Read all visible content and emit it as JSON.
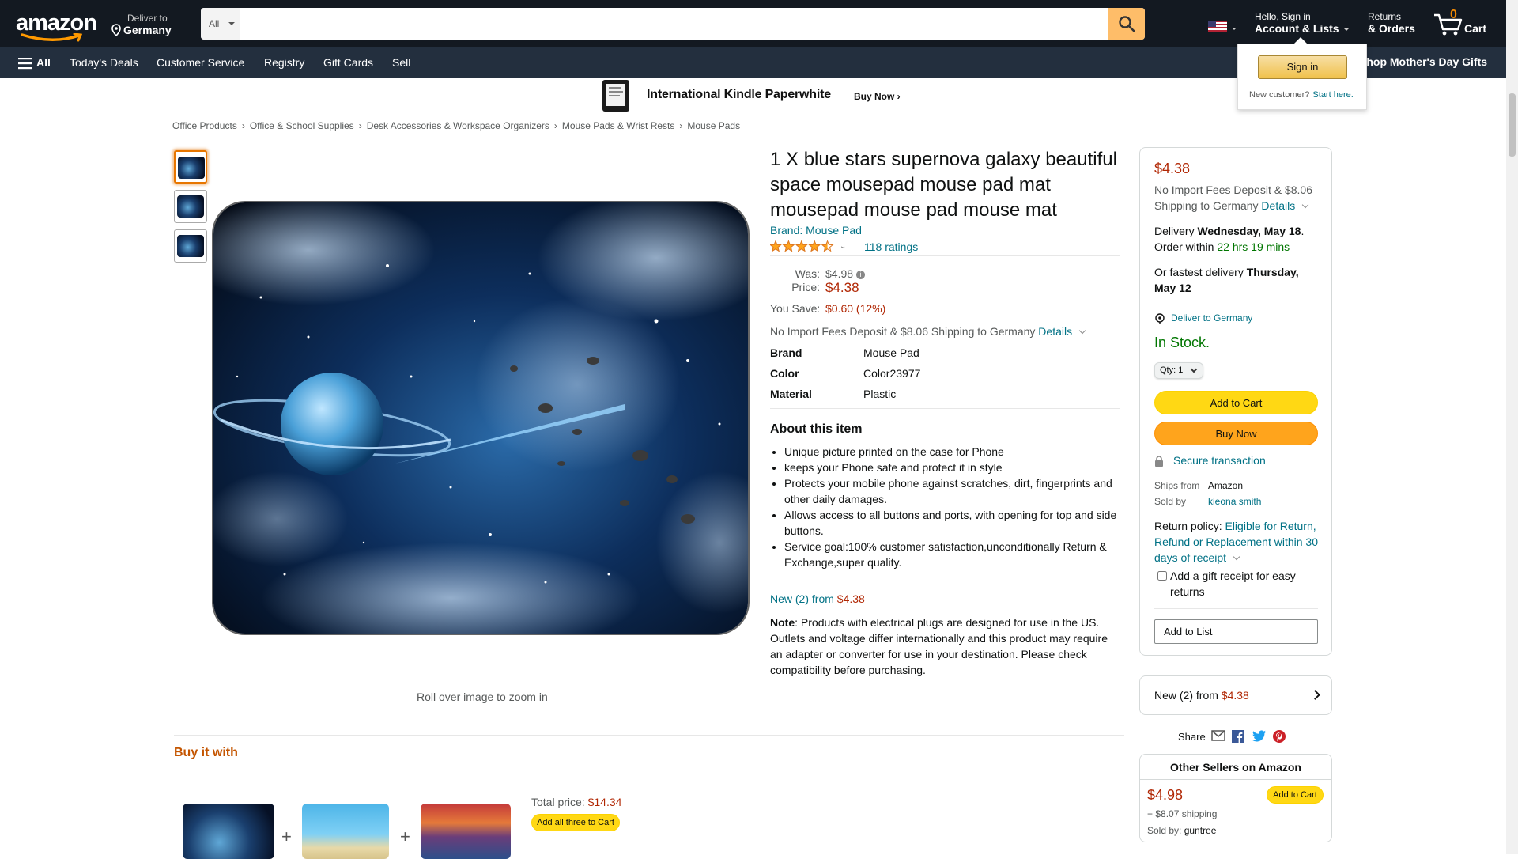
{
  "header": {
    "logo_text": "amazon",
    "deliver_line1": "Deliver to",
    "deliver_line2": "Germany",
    "search_category": "All",
    "search_placeholder": "",
    "account_line1": "Hello, Sign in",
    "account_line2": "Account & Lists",
    "returns_line1": "Returns",
    "returns_line2": "& Orders",
    "cart_count": "0",
    "cart_label": "Cart"
  },
  "nav": {
    "all_label": "All",
    "items": [
      "Today's Deals",
      "Customer Service",
      "Registry",
      "Gift Cards",
      "Sell"
    ],
    "promo": "Shop Mother's Day Gifts"
  },
  "signin_flyout": {
    "button": "Sign in",
    "new_customer": "New customer?",
    "start_here": "Start here."
  },
  "banner": {
    "text": "International Kindle Paperwhite",
    "cta": "Buy Now ›"
  },
  "breadcrumb": [
    "Office Products",
    "Office & School Supplies",
    "Desk Accessories & Workspace Organizers",
    "Mouse Pads & Wrist Rests",
    "Mouse Pads"
  ],
  "gallery": {
    "zoom_hint": "Roll over image to zoom in"
  },
  "product": {
    "title": "1 X blue stars supernova galaxy beautiful space mousepad mouse pad mat mousepad mouse pad mouse mat",
    "brand_link": "Brand: Mouse Pad",
    "rating": 4.5,
    "ratings_count": "118 ratings",
    "was_label": "Was:",
    "was_price": "$4.98",
    "price_label": "Price:",
    "price": "$4.38",
    "save_label": "You Save:",
    "save_value": "$0.60 (12%)",
    "import_text": "No Import Fees Deposit & $8.06 Shipping to Germany",
    "details_link": "Details",
    "specs": [
      {
        "k": "Brand",
        "v": "Mouse Pad"
      },
      {
        "k": "Color",
        "v": "Color23977"
      },
      {
        "k": "Material",
        "v": "Plastic"
      }
    ],
    "about_title": "About this item",
    "about": [
      "Unique picture printed on the case for Phone",
      "keeps your Phone safe and protect it in style",
      "Protects your mobile phone against scratches, dirt, fingerprints and other daily damages.",
      "Allows access to all buttons and ports, with opening for top and side buttons.",
      "Service goal:100% customer satisfaction,unconditionally Return & Exchange,super quality."
    ],
    "new_from_label": "New (2) from",
    "new_from_price": "$4.38",
    "note_label": "Note",
    "note_text": ": Products with electrical plugs are designed for use in the US. Outlets and voltage differ internationally and this product may require an adapter or converter for use in your destination. Please check compatibility before purchasing."
  },
  "buybox": {
    "price": "$4.38",
    "import_text": "No Import Fees Deposit & $8.06 Shipping to Germany",
    "details_link": "Details",
    "delivery_prefix": "Delivery",
    "delivery_date": "Wednesday, May 18",
    "order_within_prefix": "Order within",
    "order_within": "22 hrs 19 mins",
    "fastest_prefix": "Or fastest delivery",
    "fastest_date": "Thursday, May 12",
    "deliver_to": "Deliver to Germany",
    "stock": "In Stock.",
    "qty": "Qty:  1",
    "add_to_cart": "Add to Cart",
    "buy_now": "Buy Now",
    "secure": "Secure transaction",
    "ships_from_label": "Ships from",
    "ships_from": "Amazon",
    "sold_by_label": "Sold by",
    "sold_by": "kieona smith",
    "return_prefix": "Return policy:",
    "return_link": "Eligible for Return, Refund or Replacement within 30 days of receipt",
    "gift_receipt": "Add a gift receipt for easy returns",
    "add_to_list": "Add to List"
  },
  "new_box": {
    "label": "New (2) from",
    "price": "$4.38"
  },
  "share": {
    "label": "Share"
  },
  "other_sellers": {
    "title": "Other Sellers on Amazon",
    "price": "$4.98",
    "button": "Add to Cart",
    "shipping": "+ $8.07 shipping",
    "sold_by_label": "Sold by:",
    "sold_by": "guntree"
  },
  "buy_it_with": {
    "title": "Buy it with",
    "total_label": "Total price:",
    "total_price": "$14.34",
    "button": "Add all three to Cart"
  },
  "colors": {
    "header_bg": "#131921",
    "nav_bg": "#232f3e",
    "search_button": "#febd69",
    "price_red": "#B12704",
    "link": "#007185",
    "in_stock": "#007600",
    "add_to_cart": "#ffd814",
    "buy_now": "#ffa41c"
  }
}
